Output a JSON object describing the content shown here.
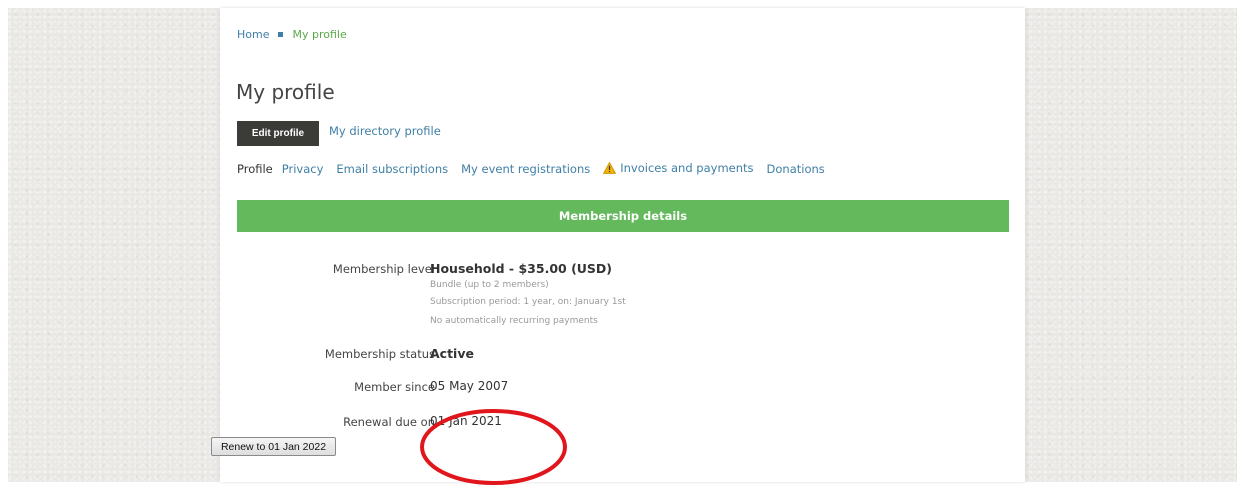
{
  "breadcrumb": {
    "home": "Home",
    "current": "My profile"
  },
  "page": {
    "title": "My profile"
  },
  "actions": {
    "edit_profile": "Edit profile",
    "directory_profile": "My directory profile"
  },
  "tabs": [
    {
      "label": "Profile",
      "active": true
    },
    {
      "label": "Privacy"
    },
    {
      "label": "Email subscriptions"
    },
    {
      "label": "My event registrations"
    },
    {
      "label": "Invoices and payments",
      "icon": "warning-icon"
    },
    {
      "label": "Donations"
    }
  ],
  "membership": {
    "section_title": "Membership details",
    "level_label": "Membership level",
    "level_value": "Household - $35.00 (USD)",
    "level_note_1": "Bundle (up to 2 members)",
    "level_note_2": "Subscription period: 1 year, on: January 1st",
    "level_note_3": "No automatically recurring payments",
    "status_label": "Membership status",
    "status_value": "Active",
    "since_label": "Member since",
    "since_value": "05 May 2007",
    "renewal_label": "Renewal due on",
    "renewal_value": "01 Jan 2021",
    "renew_button": "Renew to 01 Jan 2022"
  },
  "colors": {
    "accent_green": "#63b95c",
    "link_blue": "#3f7fa5",
    "dark_button": "#3b3b37",
    "annotation_red": "#e0161c"
  }
}
